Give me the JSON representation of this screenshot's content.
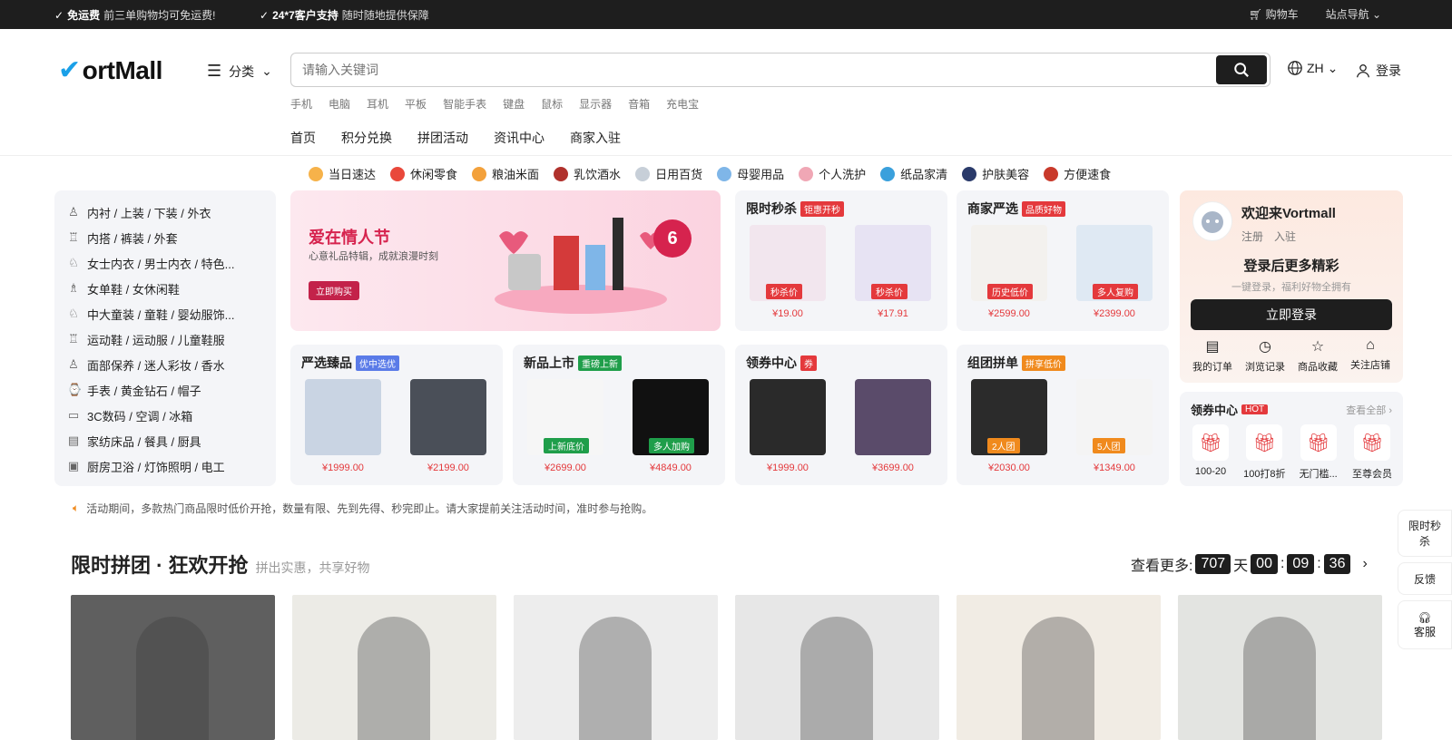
{
  "topbar": {
    "tip1_bold": "免运费",
    "tip1_text": "前三单购物均可免运费!",
    "tip2_bold": "24*7客户支持",
    "tip2_text": "随时随地提供保障",
    "cart": "购物车",
    "sitenav": "站点导航"
  },
  "header": {
    "logo": "ortMall",
    "category": "分类",
    "search_placeholder": "请输入关键词",
    "lang": "ZH",
    "login": "登录",
    "hotkeys": [
      "手机",
      "电脑",
      "耳机",
      "平板",
      "智能手表",
      "键盘",
      "鼠标",
      "显示器",
      "音箱",
      "充电宝"
    ],
    "nav": [
      "首页",
      "积分兑换",
      "拼团活动",
      "资讯中心",
      "商家入驻"
    ]
  },
  "catrow": [
    {
      "label": "当日速达",
      "color": "#f6b24a"
    },
    {
      "label": "休闲零食",
      "color": "#e9483b"
    },
    {
      "label": "粮油米面",
      "color": "#f3a13b"
    },
    {
      "label": "乳饮酒水",
      "color": "#b0312c"
    },
    {
      "label": "日用百货",
      "color": "#c7cfd8"
    },
    {
      "label": "母婴用品",
      "color": "#7fb6e8"
    },
    {
      "label": "个人洗护",
      "color": "#f0a7b5"
    },
    {
      "label": "纸品家清",
      "color": "#3aa0dc"
    },
    {
      "label": "护肤美容",
      "color": "#2a3a6a"
    },
    {
      "label": "方便速食",
      "color": "#c93a2b"
    }
  ],
  "sidecat": [
    {
      "icon": "shirt-icon",
      "text": "内衬 / 上装 / 下装 / 外衣"
    },
    {
      "icon": "tshirt-icon",
      "text": "内搭 / 裤装 / 外套"
    },
    {
      "icon": "underwear-icon",
      "text": "女士内衣 / 男士内衣 / 特色..."
    },
    {
      "icon": "heel-icon",
      "text": "女单鞋 / 女休闲鞋"
    },
    {
      "icon": "shoe-icon",
      "text": "中大童装 / 童鞋 / 婴幼服饰..."
    },
    {
      "icon": "sportswear-icon",
      "text": "运动鞋 / 运动服 / 儿童鞋服"
    },
    {
      "icon": "bottle-icon",
      "text": "面部保养 / 迷人彩妆 / 香水"
    },
    {
      "icon": "watch-icon",
      "text": "手表 / 黄金钻石 / 帽子"
    },
    {
      "icon": "monitor-icon",
      "text": "3C数码 / 空调 / 冰箱"
    },
    {
      "icon": "bed-icon",
      "text": "家纺床品 / 餐具 / 厨具"
    },
    {
      "icon": "toilet-icon",
      "text": "厨房卫浴 / 灯饰照明 / 电工"
    }
  ],
  "banner": {
    "title": "爱在情人节",
    "subtitle": "心意礼品特辑，成就浪漫时刻",
    "button": "立即购买",
    "discount": "6"
  },
  "cards": [
    {
      "title": "限时秒杀",
      "tag": "钜惠开秒",
      "tagcolor": "#e4393c",
      "items": [
        {
          "badge": "秒杀价",
          "price": "¥19.00",
          "bc": "#e4393c",
          "img": "#f2e6ee"
        },
        {
          "badge": "秒杀价",
          "price": "¥17.91",
          "bc": "#e4393c",
          "img": "#e7e3f3"
        }
      ]
    },
    {
      "title": "商家严选",
      "tag": "品质好物",
      "tagcolor": "#e4393c",
      "items": [
        {
          "badge": "历史低价",
          "price": "¥2599.00",
          "bc": "#e4393c",
          "img": "#f3f1ee"
        },
        {
          "badge": "多人复购",
          "price": "¥2399.00",
          "bc": "#e4393c",
          "img": "#dfe9f3"
        }
      ]
    },
    {
      "title": "严选臻品",
      "tag": "优中选优",
      "tagcolor": "#5a7be8",
      "items": [
        {
          "badge": "",
          "price": "¥1999.00",
          "bc": "",
          "img": "#c9d4e3"
        },
        {
          "badge": "",
          "price": "¥2199.00",
          "bc": "",
          "img": "#4a4f58"
        }
      ]
    },
    {
      "title": "新品上市",
      "tag": "重磅上新",
      "tagcolor": "#1f9e4a",
      "items": [
        {
          "badge": "上新底价",
          "price": "¥2699.00",
          "bc": "#1f9e4a",
          "img": "#f6f6f6"
        },
        {
          "badge": "多人加购",
          "price": "¥4849.00",
          "bc": "#1f9e4a",
          "img": "#111"
        }
      ]
    },
    {
      "title": "领券中心",
      "tag": "券",
      "tagcolor": "#e4393c",
      "items": [
        {
          "badge": "",
          "price": "¥1999.00",
          "bc": "",
          "img": "#2a2a2a"
        },
        {
          "badge": "",
          "price": "¥3699.00",
          "bc": "",
          "img": "#5a4b6a"
        }
      ]
    },
    {
      "title": "组团拼单",
      "tag": "拼享低价",
      "tagcolor": "#f08a1d",
      "items": [
        {
          "badge": "2人团",
          "price": "¥2030.00",
          "bc": "#f08a1d",
          "img": "#2b2b2b"
        },
        {
          "badge": "5人团",
          "price": "¥1349.00",
          "bc": "#f08a1d",
          "img": "#f4f4f4"
        }
      ]
    }
  ],
  "welcome": {
    "hi": "欢迎来Vortmall",
    "register": "注册",
    "join": "入驻",
    "more": "登录后更多精彩",
    "hint": "一键登录，福利好物全拥有",
    "button": "立即登录",
    "ops": [
      {
        "icon": "order-icon",
        "label": "我的订单"
      },
      {
        "icon": "history-icon",
        "label": "浏览记录"
      },
      {
        "icon": "star-icon",
        "label": "商品收藏"
      },
      {
        "icon": "store-icon",
        "label": "关注店铺"
      }
    ]
  },
  "coupon": {
    "title": "领券中心",
    "hot": "HOT",
    "more": "查看全部 ›",
    "items": [
      "100-20",
      "100打8折",
      "无门槛...",
      "至尊会员"
    ]
  },
  "notice": "活动期间，多款热门商品限时低价开抢，数量有限、先到先得、秒完即止。请大家提前关注活动时间，准时参与抢购。",
  "section": {
    "title": "限时拼团 · 狂欢开抢",
    "subtitle": "拼出实惠，共享好物",
    "more": "查看更多:",
    "days": "707",
    "day_unit": "天",
    "h": "00",
    "m": "09",
    "s": "36"
  },
  "products": [
    "#5f5f5f",
    "#ecebe6",
    "#ededed",
    "#e7e7e7",
    "#f1ece4",
    "#e3e4e1"
  ],
  "float": [
    "限时秒杀",
    "反馈",
    "客服"
  ]
}
